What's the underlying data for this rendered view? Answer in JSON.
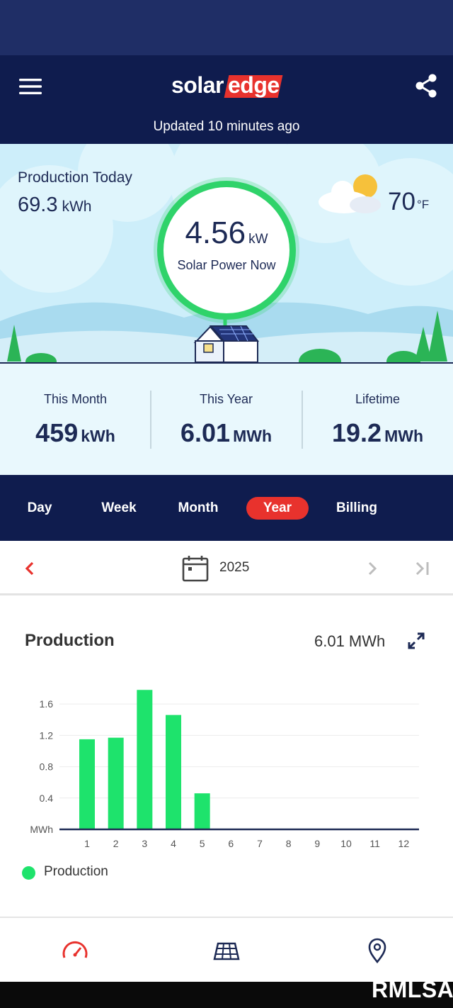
{
  "header": {
    "logo_text_solar": "solar",
    "logo_text_edge": "edge",
    "updated": "Updated 10 minutes ago"
  },
  "hero": {
    "production_today_label": "Production Today",
    "production_today_value": "69.3",
    "production_today_unit": "kWh",
    "power_now_value": "4.56",
    "power_now_unit": "kW",
    "power_now_label": "Solar Power Now",
    "temperature_value": "70",
    "temperature_unit": "°F",
    "weather_icon": "partly-cloudy-icon"
  },
  "stats": [
    {
      "label": "This Month",
      "value": "459",
      "unit": "kWh"
    },
    {
      "label": "This Year",
      "value": "6.01",
      "unit": "MWh"
    },
    {
      "label": "Lifetime",
      "value": "19.2",
      "unit": "MWh"
    }
  ],
  "tabs": [
    {
      "label": "Day",
      "active": false
    },
    {
      "label": "Week",
      "active": false
    },
    {
      "label": "Month",
      "active": false
    },
    {
      "label": "Year",
      "active": true
    },
    {
      "label": "Billing",
      "active": false
    }
  ],
  "date_nav": {
    "year": "2025"
  },
  "chart_header": {
    "title": "Production",
    "total": "6.01 MWh"
  },
  "chart_data": {
    "type": "bar",
    "categories": [
      "1",
      "2",
      "3",
      "4",
      "5",
      "6",
      "7",
      "8",
      "9",
      "10",
      "11",
      "12"
    ],
    "series": [
      {
        "name": "Production",
        "values": [
          1.15,
          1.17,
          1.78,
          1.46,
          0.46,
          0,
          0,
          0,
          0,
          0,
          0,
          0
        ]
      }
    ],
    "ylabel": "MWh",
    "yticks": [
      "0.4",
      "0.8",
      "1.2",
      "1.6"
    ],
    "ylim": [
      0,
      1.9
    ],
    "grid": true,
    "legend": "bottom-left"
  },
  "legend": {
    "label": "Production"
  },
  "bottom_nav": [
    {
      "icon": "dashboard-gauge-icon",
      "active": true
    },
    {
      "icon": "solar-panel-layout-icon",
      "active": false
    },
    {
      "icon": "location-pin-icon",
      "active": false
    }
  ],
  "colors": {
    "navy": "#0f1c4e",
    "accent_red": "#e8322d",
    "bar_green": "#1ee36c",
    "gauge_green": "#2fd36a"
  },
  "watermark": "RMLSA"
}
